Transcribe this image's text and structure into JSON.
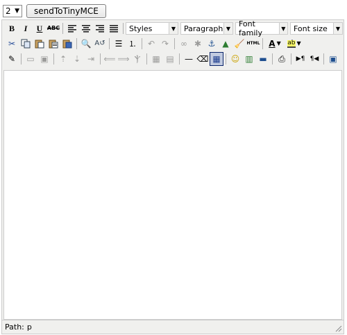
{
  "top": {
    "select_value": "2",
    "send_button_label": "sendToTinyMCE"
  },
  "toolbar1": {
    "bold": "B",
    "italic": "I",
    "underline": "U",
    "strike": "ABC",
    "styles": "Styles",
    "paragraph": "Paragraph",
    "font_family": "Font family",
    "font_size": "Font size"
  },
  "toolbar2": {
    "html_label": "HTML",
    "forecolor_label": "A",
    "backcolor_label": "ab"
  },
  "statusbar": {
    "path_label": "Path:",
    "path_value": "p"
  },
  "colors": {
    "editor_bg": "#f0f0ee",
    "border": "#cccccc",
    "active_bg": "#c2cbe0",
    "active_border": "#0a246a"
  }
}
